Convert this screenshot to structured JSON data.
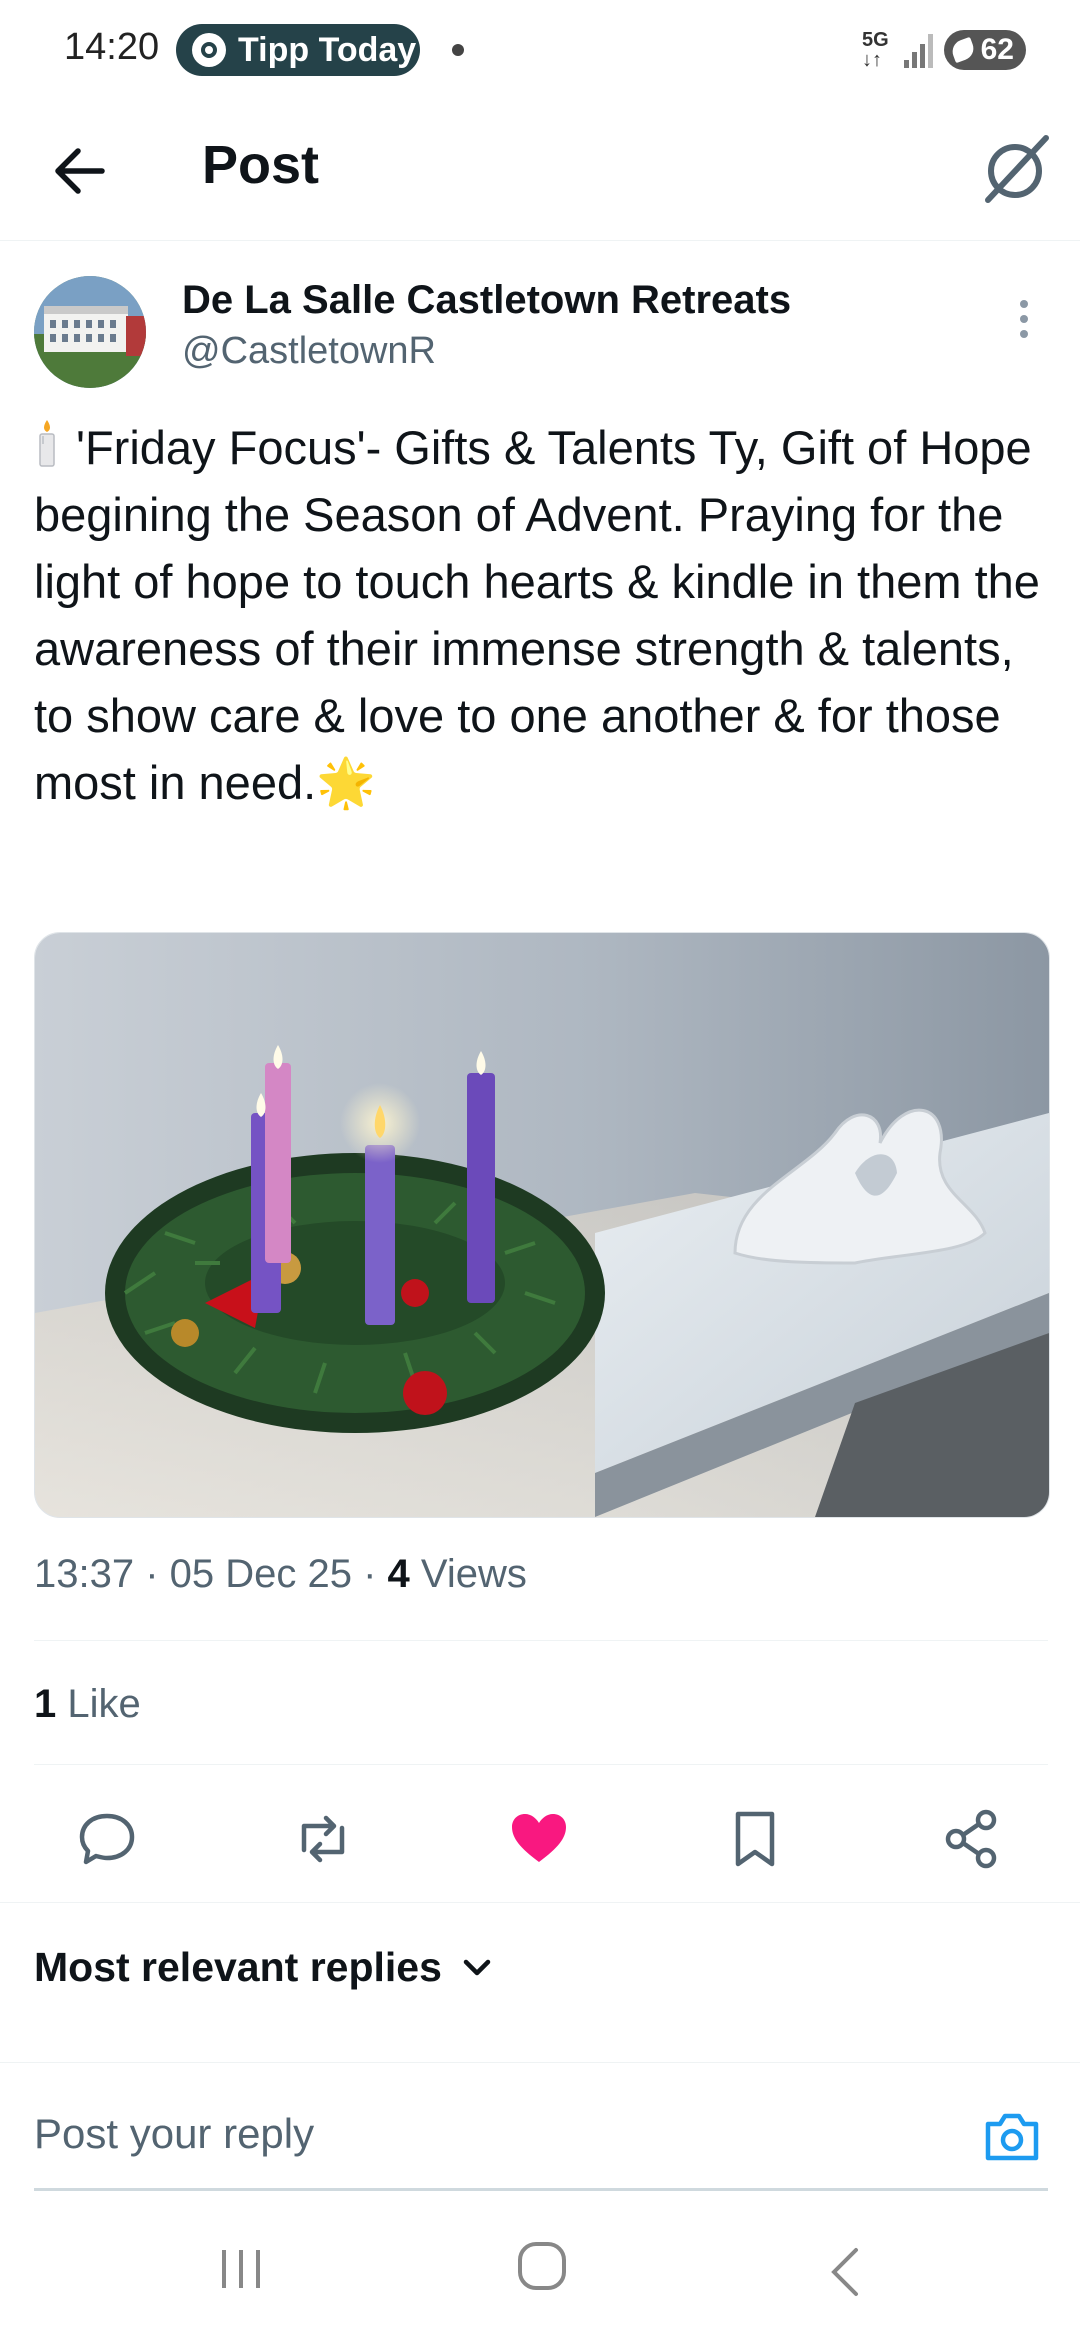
{
  "status_bar": {
    "time": "14:20",
    "notification_app": "Tipp Today",
    "network": "5G",
    "battery": "62"
  },
  "header": {
    "title": "Post"
  },
  "post": {
    "author_name": "De La Salle Castletown Retreats",
    "author_handle": "@CastletownR",
    "text": "'Friday Focus'- Gifts & Talents Ty, Gift of Hope begining the Season of Advent. Praying for the light of hope to touch hearts & kindle in them the awareness of their immense strength & talents, to show care & love to one another & for those most in need.",
    "trailing_emoji": "🌟",
    "time": "13:37",
    "date": "05 Dec 25",
    "views_count": "4",
    "views_label": "Views",
    "likes_count": "1",
    "likes_label": "Like"
  },
  "actions": [
    "reply-icon",
    "repost-icon",
    "like-icon",
    "bookmark-icon",
    "share-icon"
  ],
  "colors": {
    "like_active": "#f91880",
    "accent": "#1d9bf0",
    "secondary_text": "#536471"
  },
  "replies": {
    "sort_label": "Most relevant replies"
  },
  "reply_box": {
    "placeholder": "Post your reply"
  }
}
